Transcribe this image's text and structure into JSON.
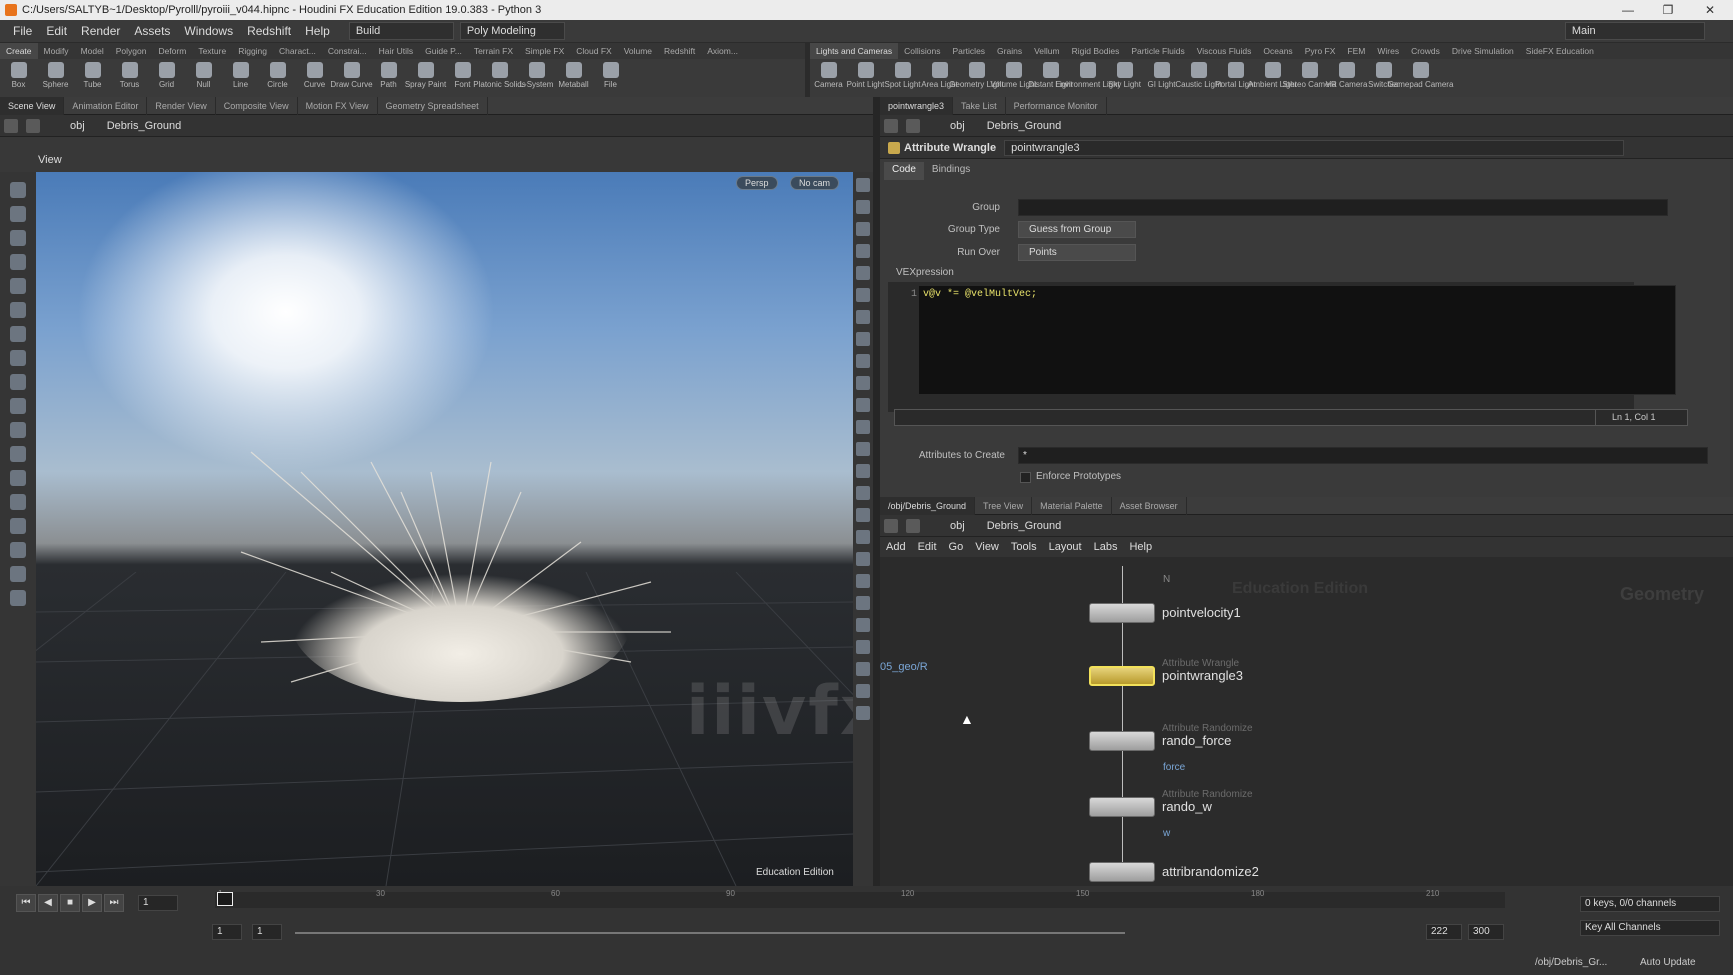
{
  "window": {
    "title": "C:/Users/SALTYB~1/Desktop/Pyrolll/pyroiii_v044.hipnc - Houdini FX Education Edition 19.0.383 - Python 3"
  },
  "menu": [
    "File",
    "Edit",
    "Render",
    "Assets",
    "Windows",
    "Redshift",
    "Help"
  ],
  "build_dropdown": "Build",
  "desktop_dropdown": "Poly Modeling",
  "desktop_name": "Main",
  "shelf_tabs_left": [
    "Create",
    "Modify",
    "Model",
    "Polygon",
    "Deform",
    "Texture",
    "Rigging",
    "Charact...",
    "Constrai...",
    "Hair Utils",
    "Guide P...",
    "Terrain FX",
    "Simple FX",
    "Cloud FX",
    "Volume",
    "Redshift",
    "Axiom..."
  ],
  "shelf_tools_left": [
    "Box",
    "Sphere",
    "Tube",
    "Torus",
    "Grid",
    "Null",
    "Line",
    "Circle",
    "Curve",
    "Draw Curve",
    "Path",
    "Spray Paint",
    "Font",
    "Platonic Solids",
    "L-System",
    "Metaball",
    "File"
  ],
  "shelf_tabs_right": [
    "Lights and Cameras",
    "Collisions",
    "Particles",
    "Grains",
    "Vellum",
    "Rigid Bodies",
    "Particle Fluids",
    "Viscous Fluids",
    "Oceans",
    "Pyro FX",
    "FEM",
    "Wires",
    "Crowds",
    "Drive Simulation",
    "SideFX Education"
  ],
  "shelf_tools_right": [
    "Camera",
    "Point Light",
    "Spot Light",
    "Area Light",
    "Geometry Light",
    "Volume Light",
    "Distant Light",
    "Environment Light",
    "Sky Light",
    "GI Light",
    "Caustic Light",
    "Portal Light",
    "Ambient Light",
    "Stereo Camera",
    "VR Camera",
    "Switcher",
    "Gamepad Camera"
  ],
  "left_tabs": [
    "Scene View",
    "Animation Editor",
    "Render View",
    "Composite View",
    "Motion FX View",
    "Geometry Spreadsheet"
  ],
  "path": {
    "root": "obj",
    "node": "Debris_Ground"
  },
  "viewport": {
    "label": "View",
    "persp": "Persp",
    "cam": "No cam",
    "edition": "Education Edition",
    "watermark": "iiivfx.com"
  },
  "right_tabs": [
    "pointwrangle3",
    "Take List",
    "Performance Monitor"
  ],
  "parm": {
    "node_type": "Attribute Wrangle",
    "node_name": "pointwrangle3",
    "tab_code": "Code",
    "tab_bindings": "Bindings",
    "group_label": "Group",
    "group_type_label": "Group Type",
    "group_type_value": "Guess from Group",
    "run_over_label": "Run Over",
    "run_over_value": "Points",
    "vex_label": "VEXpression",
    "line_no": "1",
    "code": "v@v *= @velMultVec;",
    "cursor": "Ln 1, Col 1",
    "attrs_label": "Attributes to Create",
    "attrs_value": "*",
    "enforce_label": "Enforce Prototypes"
  },
  "net_tabs": [
    "/obj/Debris_Ground",
    "Tree View",
    "Material Palette",
    "Asset Browser"
  ],
  "net_menu": [
    "Add",
    "Edit",
    "Go",
    "View",
    "Tools",
    "Layout",
    "Labs",
    "Help"
  ],
  "net": {
    "edu": "Education Edition",
    "ctx": "Geometry",
    "side_label": "05_geo/R",
    "prev": "N",
    "nodes": [
      {
        "type": "",
        "name": "pointvelocity1",
        "sub": ""
      },
      {
        "type": "Attribute Wrangle",
        "name": "pointwrangle3",
        "sub": ""
      },
      {
        "type": "Attribute Randomize",
        "name": "rando_force",
        "sub": "force"
      },
      {
        "type": "Attribute Randomize",
        "name": "rando_w",
        "sub": "w"
      },
      {
        "type": "",
        "name": "attribrandomize2",
        "sub": ""
      }
    ]
  },
  "timeline": {
    "frame": "1",
    "ticks": [
      "1",
      "30",
      "60",
      "90",
      "120",
      "150",
      "180",
      "210"
    ],
    "start": "1",
    "start2": "1",
    "end": "222",
    "end2": "300",
    "keys": "0 keys, 0/0 channels",
    "key_all": "Key All Channels",
    "auto": "Auto Update",
    "obj_path": "/obj/Debris_Gr..."
  }
}
